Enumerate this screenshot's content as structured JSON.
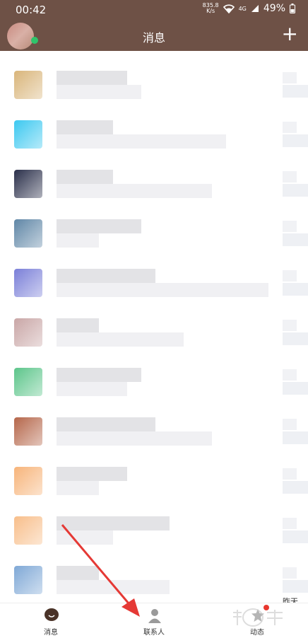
{
  "status": {
    "time": "00:42",
    "speed_value": "835.8",
    "speed_unit": "K/s",
    "network": "4G",
    "battery": "49%"
  },
  "header": {
    "title": "消息",
    "add_label": "+"
  },
  "list": {
    "rows": [
      {
        "avatar_color": "#d9b57a",
        "l1": 100,
        "l2": 120
      },
      {
        "avatar_color": "#3cc8f0",
        "l1": 80,
        "l2": 240
      },
      {
        "avatar_color": "#2a2f4a",
        "l1": 80,
        "l2": 220
      },
      {
        "avatar_color": "#5f86a6",
        "l1": 120,
        "l2": 60
      },
      {
        "avatar_color": "#7a7fd8",
        "l1": 140,
        "l2": 300
      },
      {
        "avatar_color": "#c9a6a6",
        "l1": 60,
        "l2": 180
      },
      {
        "avatar_color": "#5cc58a",
        "l1": 120,
        "l2": 100
      },
      {
        "avatar_color": "#b5664a",
        "l1": 140,
        "l2": 220
      },
      {
        "avatar_color": "#f7b47a",
        "l1": 100,
        "l2": 60
      },
      {
        "avatar_color": "#f8be8a",
        "l1": 160,
        "l2": 80
      },
      {
        "avatar_color": "#7fa8d6",
        "l1": 60,
        "l2": 160
      }
    ],
    "last_time": "昨天"
  },
  "tabs": [
    {
      "label": "消息",
      "icon": "message-icon"
    },
    {
      "label": "联系人",
      "icon": "contacts-icon"
    },
    {
      "label": "动态",
      "icon": "feed-icon"
    }
  ],
  "colors": {
    "header": "#6e5146",
    "arrow": "#e53935",
    "online": "#2fc46b"
  }
}
